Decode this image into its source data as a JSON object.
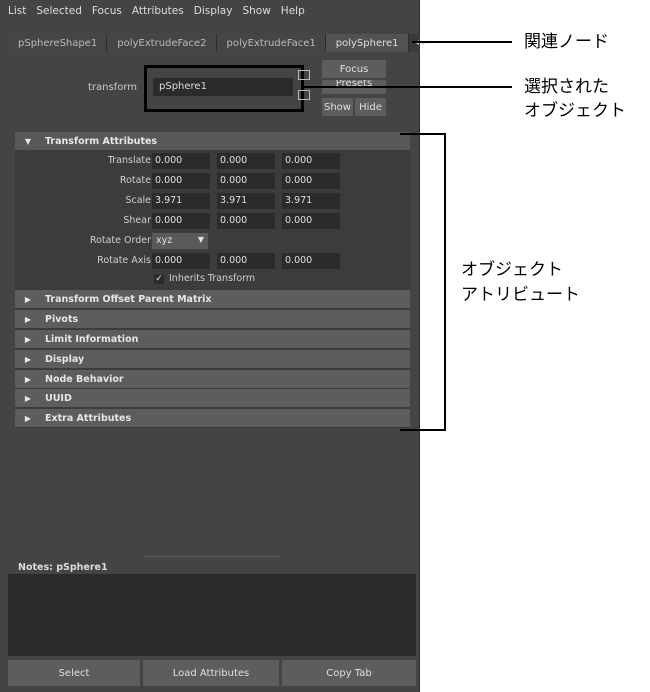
{
  "menubar": {
    "items": [
      "List",
      "Selected",
      "Focus",
      "Attributes",
      "Display",
      "Show",
      "Help"
    ]
  },
  "node_tabs": {
    "items": [
      "pSphereShape1",
      "polyExtrudeFace2",
      "polyExtrudeFace1",
      "polySphere1"
    ],
    "active_index": 3,
    "arrows_icon": "◂ ▸"
  },
  "transform_row": {
    "label": "transform",
    "value": "pSphere1",
    "focus_label": "Focus",
    "presets_label": "Presets",
    "show_label": "Show",
    "hide_label": "Hide"
  },
  "transform_attributes": {
    "header": "Transform Attributes",
    "rows": [
      {
        "label": "Translate",
        "values": [
          "0.000",
          "0.000",
          "0.000"
        ]
      },
      {
        "label": "Rotate",
        "values": [
          "0.000",
          "0.000",
          "0.000"
        ]
      },
      {
        "label": "Scale",
        "values": [
          "3.971",
          "3.971",
          "3.971"
        ]
      },
      {
        "label": "Shear",
        "values": [
          "0.000",
          "0.000",
          "0.000"
        ]
      }
    ],
    "rotate_order": {
      "label": "Rotate Order",
      "value": "xyz"
    },
    "rotate_axis": {
      "label": "Rotate Axis",
      "values": [
        "0.000",
        "0.000",
        "0.000"
      ]
    },
    "inherits": {
      "label": "Inherits Transform",
      "checked": true
    }
  },
  "collapsed_sections": [
    "Transform Offset Parent Matrix",
    "Pivots",
    "Limit Information",
    "Display",
    "Node Behavior",
    "UUID",
    "Extra Attributes"
  ],
  "notes": {
    "label": "Notes:  pSphere1"
  },
  "bottom_buttons": {
    "select": "Select",
    "load": "Load Attributes",
    "copy": "Copy Tab"
  },
  "annotations": {
    "related_nodes": "関連ノード",
    "selected_object_line1": "選択された",
    "selected_object_line2": "オブジェクト",
    "object_attributes_line1": "オブジェクト",
    "object_attributes_line2": "アトリビュート"
  },
  "colors": {
    "panel": "#444444",
    "field": "#2b2b2b",
    "header": "#5d5d5d",
    "button": "#5d5d5d"
  }
}
